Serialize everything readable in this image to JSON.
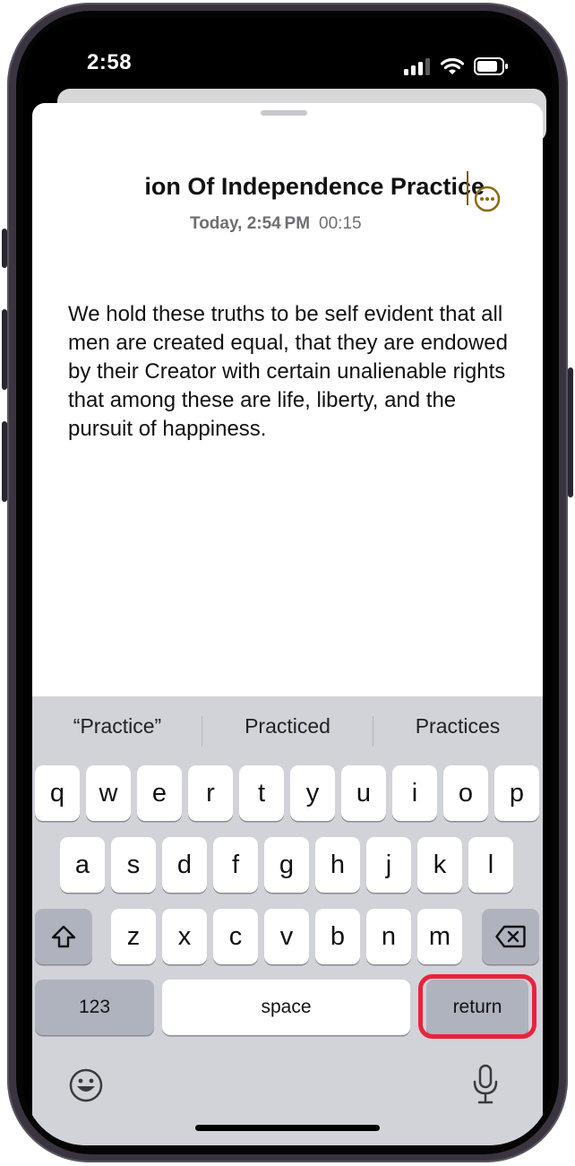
{
  "status_bar": {
    "time": "2:58"
  },
  "note": {
    "title": "ion Of Independence Practice",
    "date": "Today, 2:54 PM",
    "duration": "00:15",
    "body": "We hold these truths to be self evident that all men are created equal, that they are endowed by their Creator with certain unalienable rights that among these are life, liberty, and the pursuit of happiness."
  },
  "suggestions": [
    "“Practice”",
    "Practiced",
    "Practices"
  ],
  "keyboard": {
    "row1": [
      "q",
      "w",
      "e",
      "r",
      "t",
      "y",
      "u",
      "i",
      "o",
      "p"
    ],
    "row2": [
      "a",
      "s",
      "d",
      "f",
      "g",
      "h",
      "j",
      "k",
      "l"
    ],
    "row3": [
      "z",
      "x",
      "c",
      "v",
      "b",
      "n",
      "m"
    ],
    "numbers_label": "123",
    "space_label": "space",
    "return_label": "return"
  },
  "colors": {
    "accent": "#8a6a12",
    "highlight": "#e8233c"
  }
}
